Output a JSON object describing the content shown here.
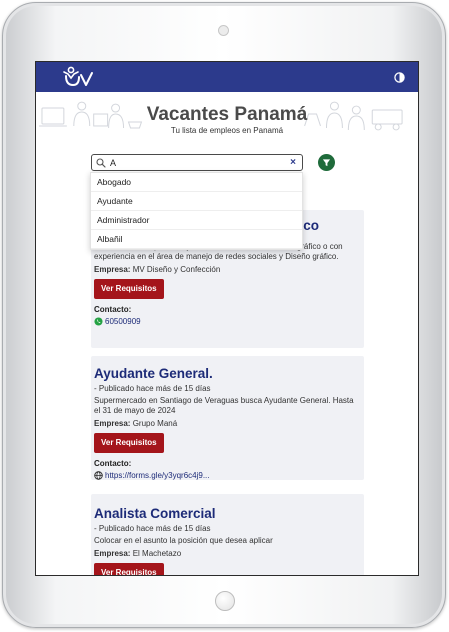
{
  "header": {
    "logo_text": "UV",
    "contrast_icon": "contrast-icon",
    "accent": "#2c3a8c"
  },
  "hero": {
    "title": "Vacantes Panamá",
    "subtitle": "Tu lista de empleos en Panamá"
  },
  "search": {
    "value": "A",
    "clear_icon": "×",
    "filter_icon": "filter-icon"
  },
  "suggestions": [
    "Abogado",
    "Ayudante",
    "Administrador",
    "Albañil"
  ],
  "cards": [
    {
      "title": "Diseñador gráfico",
      "title_visible_tail": "gráfico",
      "description": "Estamos en búsqueda de jóvenes estudiantes de diseño gráfico o con experiencia en el área de manejo de redes sociales y Diseño gráfico.",
      "company_label": "Empresa:",
      "company": "MV Diseño y Confección",
      "button": "Ver Requisitos",
      "contact_label": "Contacto:",
      "contact": "60500909",
      "contact_icon": "whatsapp-icon"
    },
    {
      "title": "Ayudante General.",
      "meta": "- Publicado hace más de 15 días",
      "description": "Supermercado en Santiago de Veraguas busca Ayudante General. Hasta el 31 de mayo de 2024",
      "company_label": "Empresa:",
      "company": "Grupo Maná",
      "button": "Ver Requisitos",
      "contact_label": "Contacto:",
      "contact": "https://forms.gle/y3yqr6c4j9...",
      "contact_icon": "globe-icon"
    },
    {
      "title": "Analista Comercial",
      "meta": "- Publicado hace más de 15 días",
      "description": "Colocar en el asunto la posición que desea aplicar",
      "company_label": "Empresa:",
      "company": "El Machetazo",
      "button": "Ver Requisitos"
    }
  ],
  "colors": {
    "title_blue": "#1d2b78",
    "button_red": "#a4151b",
    "filter_green": "#1f6b3b",
    "card_bg": "#f0f1f5"
  }
}
